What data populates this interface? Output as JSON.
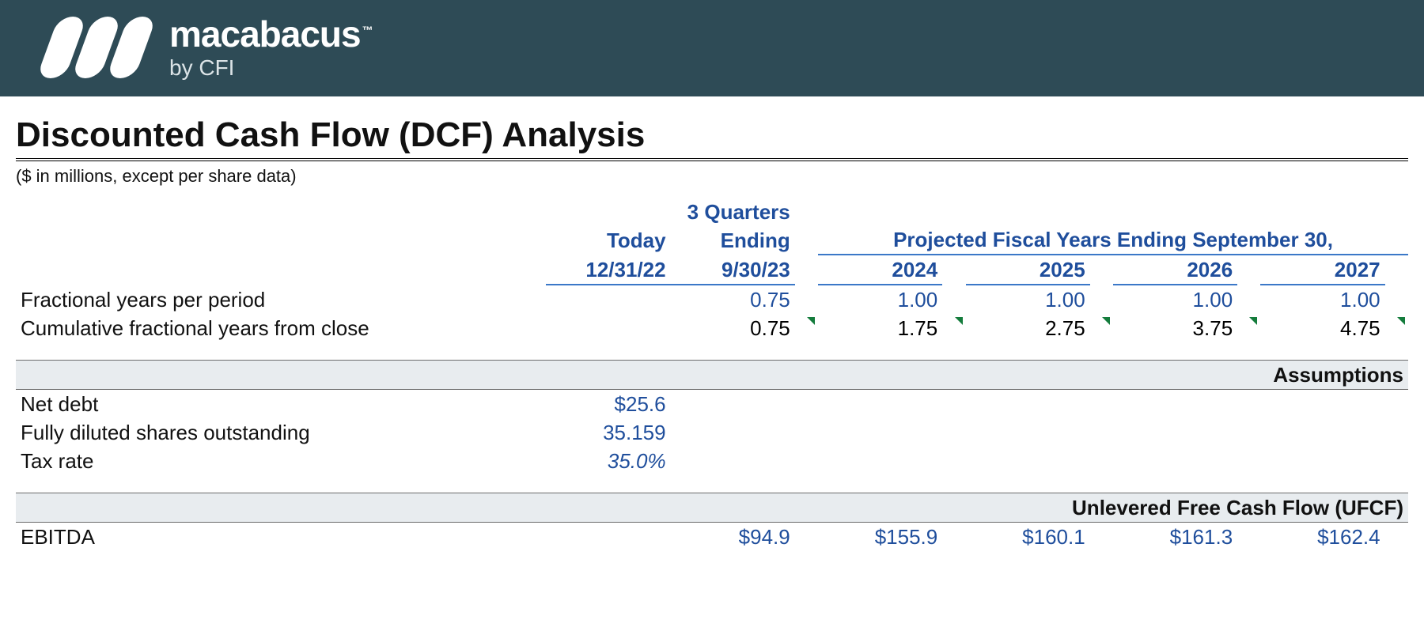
{
  "brand": {
    "name": "macabacus",
    "tm": "™",
    "byline": "by CFI"
  },
  "title": "Discounted Cash Flow (DCF) Analysis",
  "subtitle": "($ in millions, except per share data)",
  "headers": {
    "today_label": "Today",
    "today_date": "12/31/22",
    "stub_label_line1": "3 Quarters",
    "stub_label_line2": "Ending",
    "stub_date": "9/30/23",
    "proj_span": "Projected Fiscal Years Ending September 30,",
    "years": {
      "y1": "2024",
      "y2": "2025",
      "y3": "2026",
      "y4": "2027"
    }
  },
  "rows": {
    "frac_label": "Fractional years per period",
    "frac": {
      "stub": "0.75",
      "y1": "1.00",
      "y2": "1.00",
      "y3": "1.00",
      "y4": "1.00"
    },
    "cum_label": "Cumulative fractional years from close",
    "cum": {
      "stub": "0.75",
      "y1": "1.75",
      "y2": "2.75",
      "y3": "3.75",
      "y4": "4.75"
    }
  },
  "sections": {
    "assumptions_title": "Assumptions",
    "ufcf_title": "Unlevered Free Cash Flow (UFCF)"
  },
  "assumptions": {
    "net_debt_label": "Net debt",
    "net_debt": "$25.6",
    "shares_label": "Fully diluted shares outstanding",
    "shares": "35.159",
    "tax_label": "Tax rate",
    "tax": "35.0%"
  },
  "ufcf": {
    "ebitda_label": "EBITDA",
    "ebitda": {
      "stub": "$94.9",
      "y1": "$155.9",
      "y2": "$160.1",
      "y3": "$161.3",
      "y4": "$162.4"
    }
  }
}
